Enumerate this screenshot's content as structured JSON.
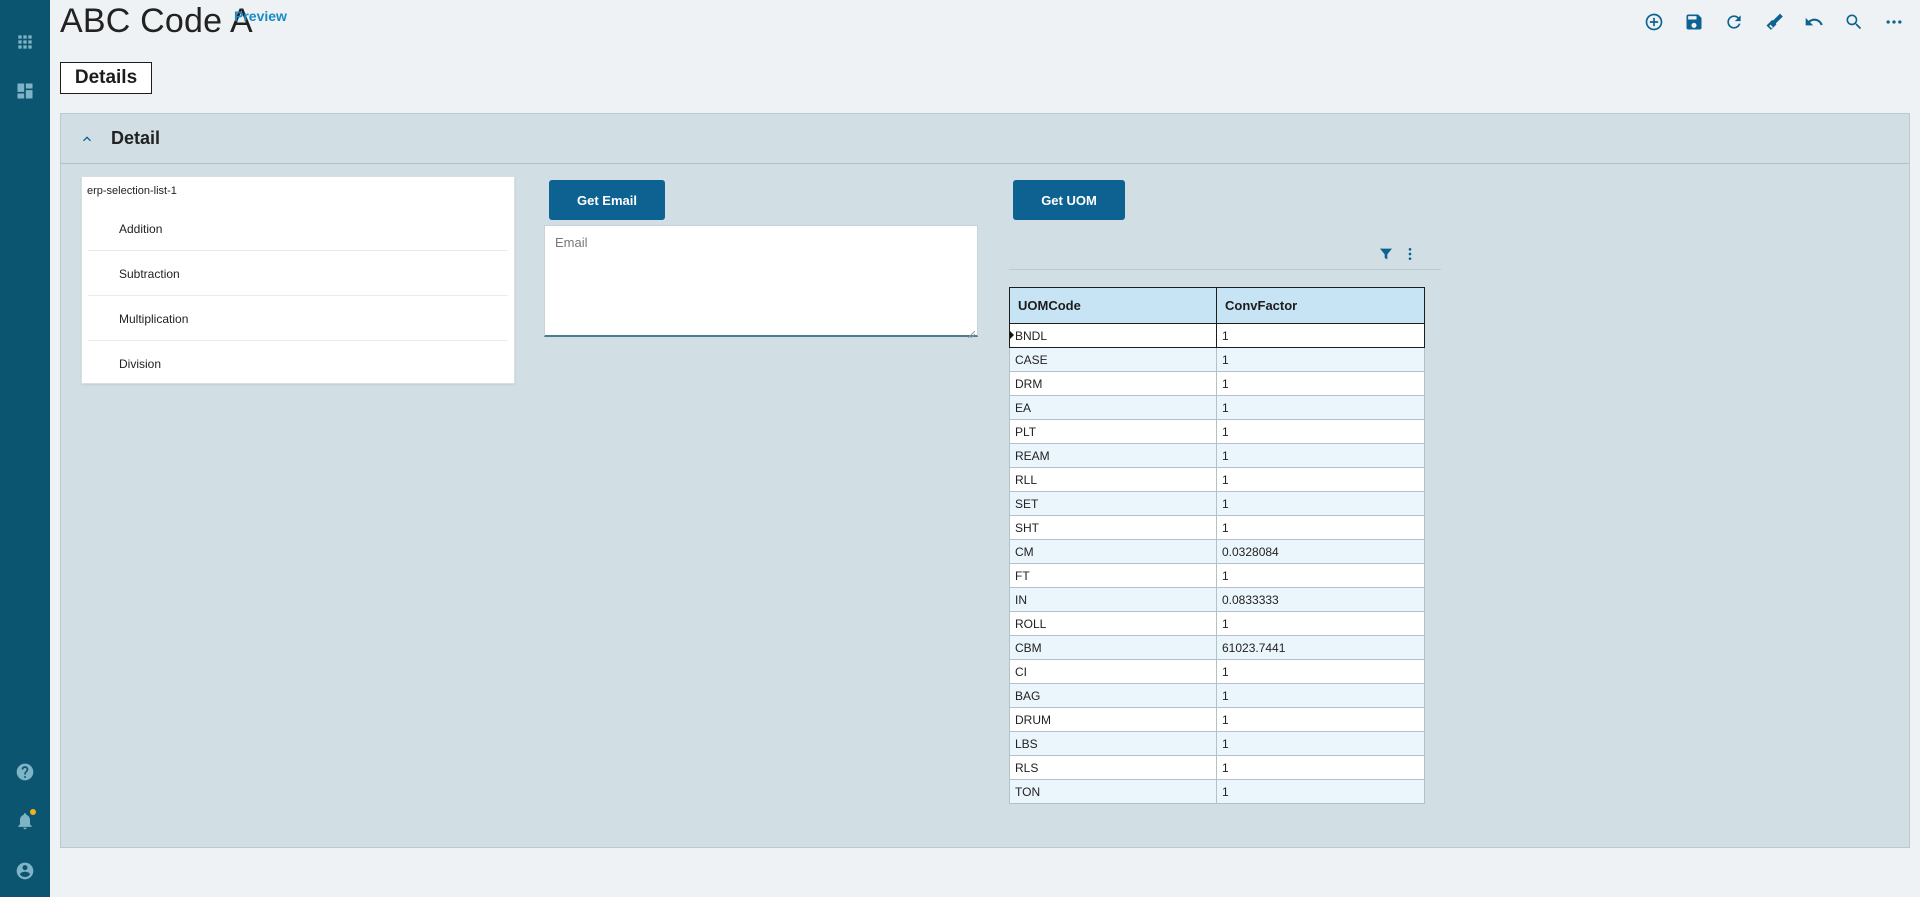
{
  "header": {
    "title": "ABC Code A",
    "badge": "Preview",
    "tab": "Details"
  },
  "toolbar": [
    "add-icon",
    "save-icon",
    "refresh-icon",
    "clear-icon",
    "undo-icon",
    "search-icon",
    "more-icon"
  ],
  "rail": {
    "top_icons": [
      "apps-grid-icon",
      "dashboard-icon"
    ],
    "bottom_icons": [
      "help-icon",
      "notification-icon",
      "user-icon"
    ],
    "notification_dot_color": "#f2b01e"
  },
  "panel": {
    "title": "Detail",
    "selection_list": {
      "label": "erp-selection-list-1",
      "items": [
        "Addition",
        "Subtraction",
        "Multiplication",
        "Division"
      ]
    },
    "get_email_button": "Get Email",
    "email_placeholder": "Email",
    "get_uom_button": "Get UOM",
    "grid": {
      "columns": [
        "UOMCode",
        "ConvFactor"
      ],
      "rows": [
        [
          "BNDL",
          "1"
        ],
        [
          "CASE",
          "1"
        ],
        [
          "DRM",
          "1"
        ],
        [
          "EA",
          "1"
        ],
        [
          "PLT",
          "1"
        ],
        [
          "REAM",
          "1"
        ],
        [
          "RLL",
          "1"
        ],
        [
          "SET",
          "1"
        ],
        [
          "SHT",
          "1"
        ],
        [
          "CM",
          "0.0328084"
        ],
        [
          "FT",
          "1"
        ],
        [
          "IN",
          "0.0833333"
        ],
        [
          "ROLL",
          "1"
        ],
        [
          "CBM",
          "61023.7441"
        ],
        [
          "CI",
          "1"
        ],
        [
          "BAG",
          "1"
        ],
        [
          "DRUM",
          "1"
        ],
        [
          "LBS",
          "1"
        ],
        [
          "RLS",
          "1"
        ],
        [
          "TON",
          "1"
        ]
      ]
    }
  },
  "colors": {
    "rail": "#0c5570",
    "accent": "#0d6291",
    "panel": "#d1dfe4",
    "grid_header": "#c6e4f4"
  }
}
